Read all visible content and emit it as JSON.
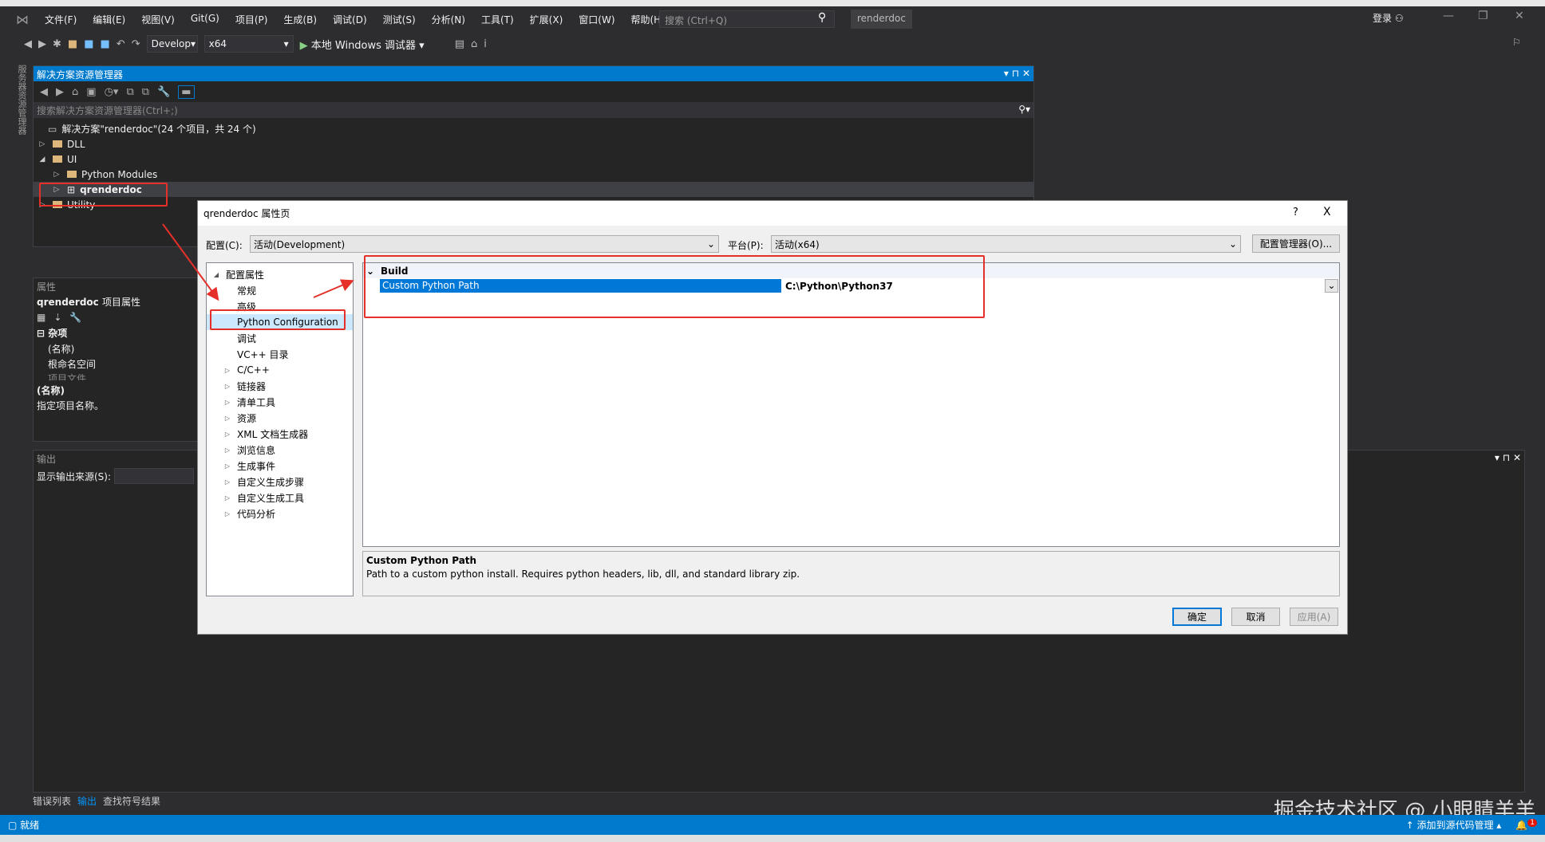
{
  "menu": [
    "文件(F)",
    "编辑(E)",
    "视图(V)",
    "Git(G)",
    "项目(P)",
    "生成(B)",
    "调试(D)",
    "测试(S)",
    "分析(N)",
    "工具(T)",
    "扩展(X)",
    "窗口(W)",
    "帮助(H)"
  ],
  "search_placeholder": "搜索 (Ctrl+Q)",
  "app_name": "renderdoc",
  "login": "登录",
  "toolbar": {
    "config": "Develop",
    "platform": "x64",
    "run": "本地 Windows 调试器"
  },
  "side_tab": "服务器资源管理器",
  "solution_explorer": {
    "title": "解决方案资源管理器",
    "search": "搜索解决方案资源管理器(Ctrl+;)",
    "items": [
      {
        "label": "解决方案\"renderdoc\"(24 个项目，共 24 个)"
      },
      {
        "label": "DLL"
      },
      {
        "label": "UI"
      },
      {
        "label": "Python Modules"
      },
      {
        "label": "qrenderdoc"
      },
      {
        "label": "Utility"
      }
    ]
  },
  "properties": {
    "title": "属性",
    "object": "qrenderdoc",
    "object_type": "项目属性",
    "category": "杂项",
    "rows": [
      "(名称)",
      "根命名空间",
      "项目文件"
    ],
    "desc_title": "(名称)",
    "desc_text": "指定项目名称。"
  },
  "output": {
    "title": "输出",
    "source_label": "显示输出来源(S):"
  },
  "bottom_tabs": [
    "错误列表",
    "输出",
    "查找符号结果"
  ],
  "status": {
    "ready": "就绪",
    "source_control": "添加到源代码管理",
    "notif_count": "1"
  },
  "watermark": "掘金技术社区 @ 小眼睛羊羊",
  "dialog": {
    "title": "qrenderdoc 属性页",
    "help": "?",
    "close": "X",
    "config_label": "配置(C):",
    "config_value": "活动(Development)",
    "platform_label": "平台(P):",
    "platform_value": "活动(x64)",
    "config_manager": "配置管理器(O)...",
    "tree": [
      {
        "label": "配置属性",
        "level": 0,
        "arrow": "◢"
      },
      {
        "label": "常规",
        "level": 1,
        "arrow": ""
      },
      {
        "label": "高级",
        "level": 1,
        "arrow": ""
      },
      {
        "label": "Python Configuration",
        "level": 1,
        "arrow": "",
        "selected": true
      },
      {
        "label": "调试",
        "level": 1,
        "arrow": ""
      },
      {
        "label": "VC++ 目录",
        "level": 1,
        "arrow": ""
      },
      {
        "label": "C/C++",
        "level": 1,
        "arrow": "▷"
      },
      {
        "label": "链接器",
        "level": 1,
        "arrow": "▷"
      },
      {
        "label": "清单工具",
        "level": 1,
        "arrow": "▷"
      },
      {
        "label": "资源",
        "level": 1,
        "arrow": "▷"
      },
      {
        "label": "XML 文档生成器",
        "level": 1,
        "arrow": "▷"
      },
      {
        "label": "浏览信息",
        "level": 1,
        "arrow": "▷"
      },
      {
        "label": "生成事件",
        "level": 1,
        "arrow": "▷"
      },
      {
        "label": "自定义生成步骤",
        "level": 1,
        "arrow": "▷"
      },
      {
        "label": "自定义生成工具",
        "level": 1,
        "arrow": "▷"
      },
      {
        "label": "代码分析",
        "level": 1,
        "arrow": "▷"
      }
    ],
    "group": "Build",
    "prop_name": "Custom Python Path",
    "prop_value": "C:\\Python\\Python37",
    "desc_title": "Custom Python Path",
    "desc_text": "Path to a custom python install. Requires python headers, lib, dll, and standard library zip.",
    "ok": "确定",
    "cancel": "取消",
    "apply": "应用(A)"
  },
  "colors": {
    "accent": "#007acc",
    "annotation": "#e5302a",
    "selection": "#0078d7"
  }
}
